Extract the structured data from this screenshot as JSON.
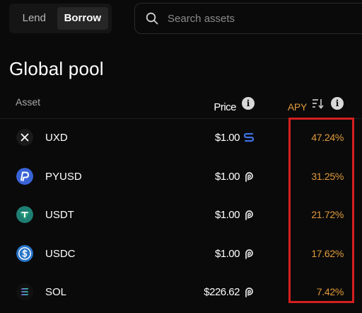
{
  "tabs": {
    "lend_label": "Lend",
    "borrow_label": "Borrow",
    "active": "Borrow"
  },
  "search": {
    "placeholder": "Search assets",
    "value": ""
  },
  "title": "Global pool",
  "table": {
    "headers": {
      "asset": "Asset",
      "price": "Price",
      "apy": "APY"
    },
    "rows": [
      {
        "symbol": "UXD",
        "price": "$1.00",
        "oracle": "switchboard-icon",
        "apy": "47.24%"
      },
      {
        "symbol": "PYUSD",
        "price": "$1.00",
        "oracle": "pyth-icon",
        "apy": "31.25%"
      },
      {
        "symbol": "USDT",
        "price": "$1.00",
        "oracle": "pyth-icon",
        "apy": "21.72%"
      },
      {
        "symbol": "USDC",
        "price": "$1.00",
        "oracle": "pyth-icon",
        "apy": "17.62%"
      },
      {
        "symbol": "SOL",
        "price": "$226.62",
        "oracle": "pyth-icon",
        "apy": "7.42%"
      }
    ]
  },
  "colors": {
    "background": "#0a0a0a",
    "apy_text": "#e09a3c",
    "highlight_box": "#d41f1f",
    "switchboard_blue": "#3b6fe0"
  }
}
